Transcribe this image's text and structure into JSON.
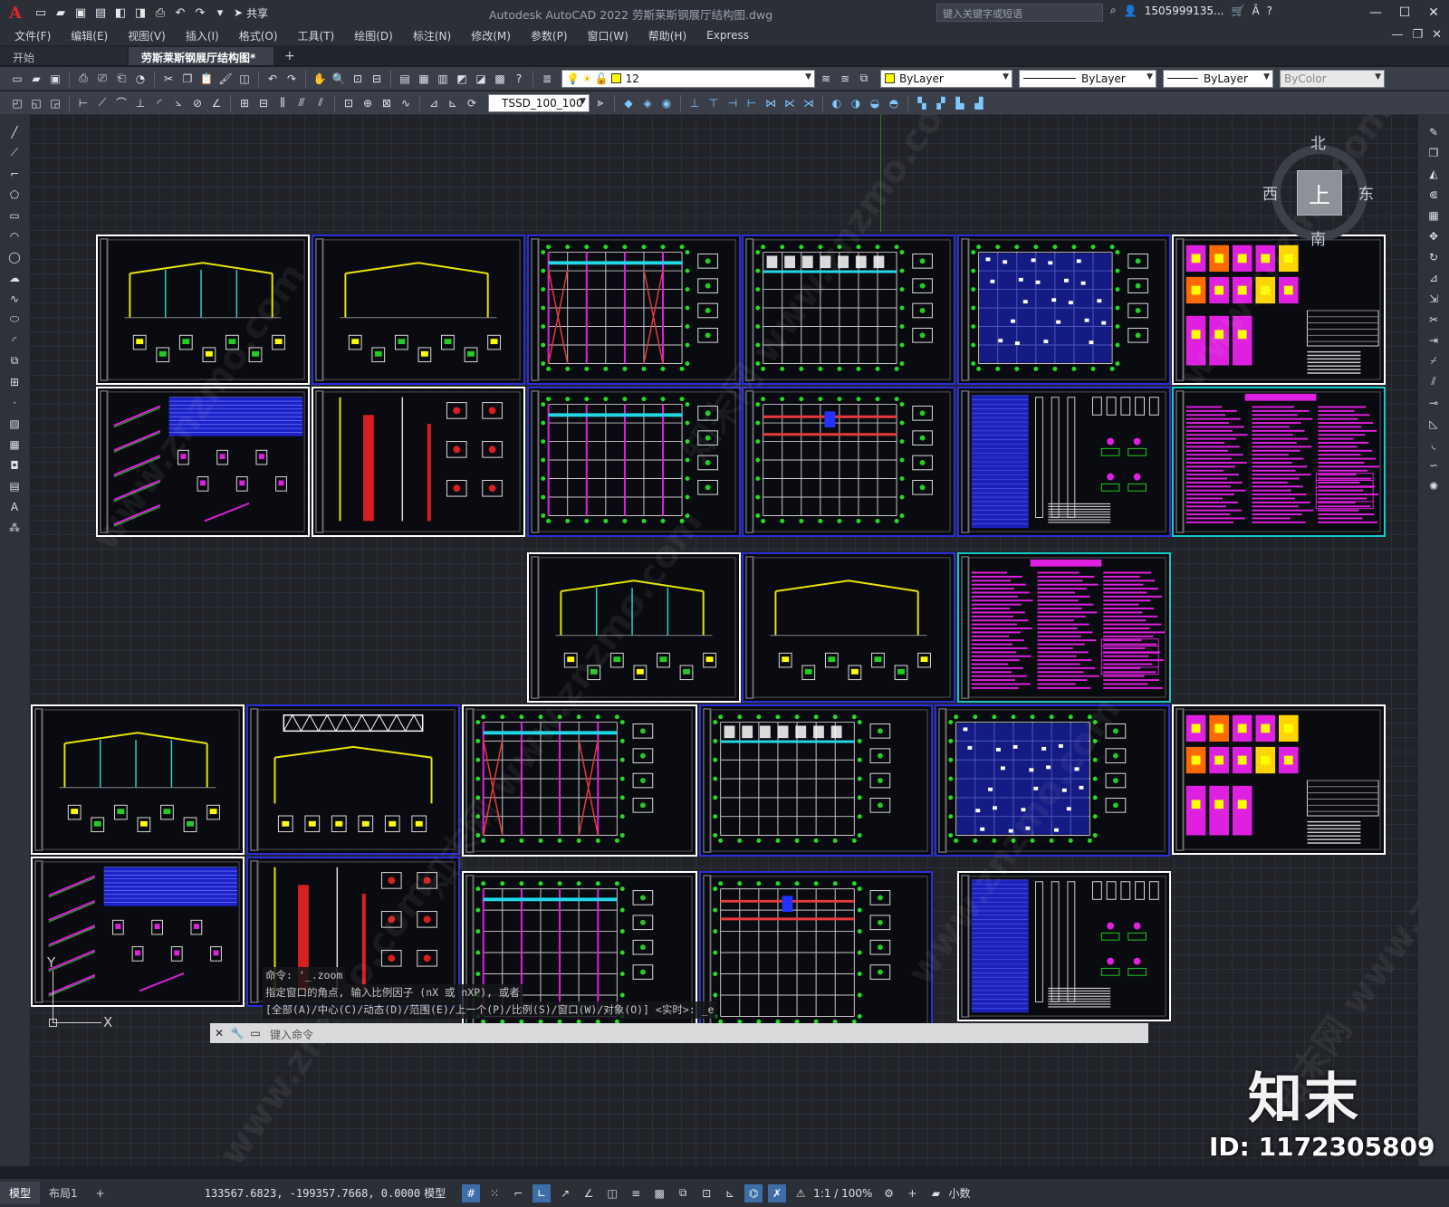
{
  "app": {
    "logo": "A",
    "title": "Autodesk AutoCAD 2022    劳斯莱斯钢展厅结构图.dwg",
    "share_label": "共享",
    "search_placeholder": "键入关键字或短语",
    "user": "1505999135...",
    "help": "?"
  },
  "menu": [
    "文件(F)",
    "编辑(E)",
    "视图(V)",
    "插入(I)",
    "格式(O)",
    "工具(T)",
    "绘图(D)",
    "标注(N)",
    "修改(M)",
    "参数(P)",
    "窗口(W)",
    "帮助(H)",
    "Express"
  ],
  "tabs": {
    "start": "开始",
    "drawing": "劳斯莱斯钢展厅结构图*",
    "add": "+"
  },
  "properties": {
    "layer": "12",
    "color": "ByLayer",
    "color_swatch": "#ffff00",
    "layer_swatch": "#ffff00",
    "linetype": "ByLayer",
    "lineweight": "ByLayer",
    "plotstyle": "ByColor",
    "dimstyle": "TSSD_100_100"
  },
  "viewcube": {
    "north": "北",
    "south": "南",
    "east": "东",
    "west": "西",
    "top": "上"
  },
  "ucs": {
    "x": "X",
    "y": "Y"
  },
  "command": {
    "history": [
      "命令: '_.zoom",
      "指定窗口的角点, 输入比例因子 (nX 或 nXP), 或者",
      "[全部(A)/中心(C)/动态(D)/范围(E)/上一个(P)/比例(S)/窗口(W)/对象(O)] <实时>: _e"
    ],
    "placeholder": "键入命令"
  },
  "watermark": {
    "logo": "知末",
    "id": "ID: 1172305809",
    "repeat": "www.znzmo.com",
    "repeat_cn": "知末网"
  },
  "status": {
    "model_tab": "模型",
    "layout_tab": "布局1",
    "add_tab": "+",
    "coords": "133567.6823, -199357.7668, 0.0000",
    "space": "模型",
    "scale": "1:1 / 100%",
    "units": "小数"
  },
  "colors": {
    "accent": "#3d6ea8",
    "sheet_white": "#ffffff",
    "sheet_blue": "#2a2fd6",
    "sheet_cyan": "#14c8c8",
    "magenta": "#e020e0",
    "green": "#22dd22"
  }
}
